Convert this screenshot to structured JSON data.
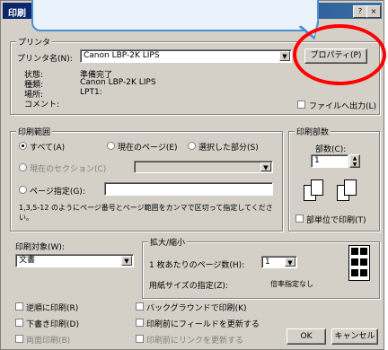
{
  "window": {
    "title": "印刷",
    "help_glyph": "?",
    "close_glyph": "×"
  },
  "printer": {
    "group_label": "プリンタ",
    "name_label": "プリンタ名(N):",
    "name_value": "Canon LBP-2K LIPS",
    "properties_button": "プロパティ(P)",
    "status_label": "状態:",
    "status_value": "準備完了",
    "type_label": "種類:",
    "type_value": "Canon LBP-2K LIPS",
    "location_label": "場所:",
    "location_value": "LPT1:",
    "comment_label": "コメント:",
    "print_to_file": "ファイルへ出力(L)"
  },
  "page_range": {
    "group_label": "印刷範囲",
    "all": "すべて(A)",
    "current": "現在のページ(E)",
    "selection": "選択した部分(S)",
    "current_section": "現在のセクション(C)",
    "pages": "ページ指定(G):",
    "hint": "1,3,5-12 のようにページ番号とページ範囲をカンマで区切って指定してください。"
  },
  "copies": {
    "group_label": "印刷部数",
    "count_label": "部数(C):",
    "count_value": "1",
    "collate": "部単位で印刷(T)"
  },
  "print_what": {
    "label": "印刷対象(W):",
    "value": "文書"
  },
  "zoom": {
    "group_label": "拡大/縮小",
    "pages_per_sheet_label": "1 枚あたりのページ数(H):",
    "pages_per_sheet_value": "1",
    "scale_label": "用紙サイズの指定(Z):",
    "scale_value": "倍率指定なし"
  },
  "options": {
    "reverse": "逆順に印刷(R)",
    "draft": "下書き印刷(D)",
    "both_sides": "両面印刷(B)",
    "background": "バックグラウンドで印刷(K)",
    "update_fields": "印刷前にフィールドを更新する",
    "update_links": "印刷前にリンクを更新する"
  },
  "buttons": {
    "ok": "OK",
    "cancel": "キャンセル"
  },
  "callout": {
    "text": ""
  }
}
